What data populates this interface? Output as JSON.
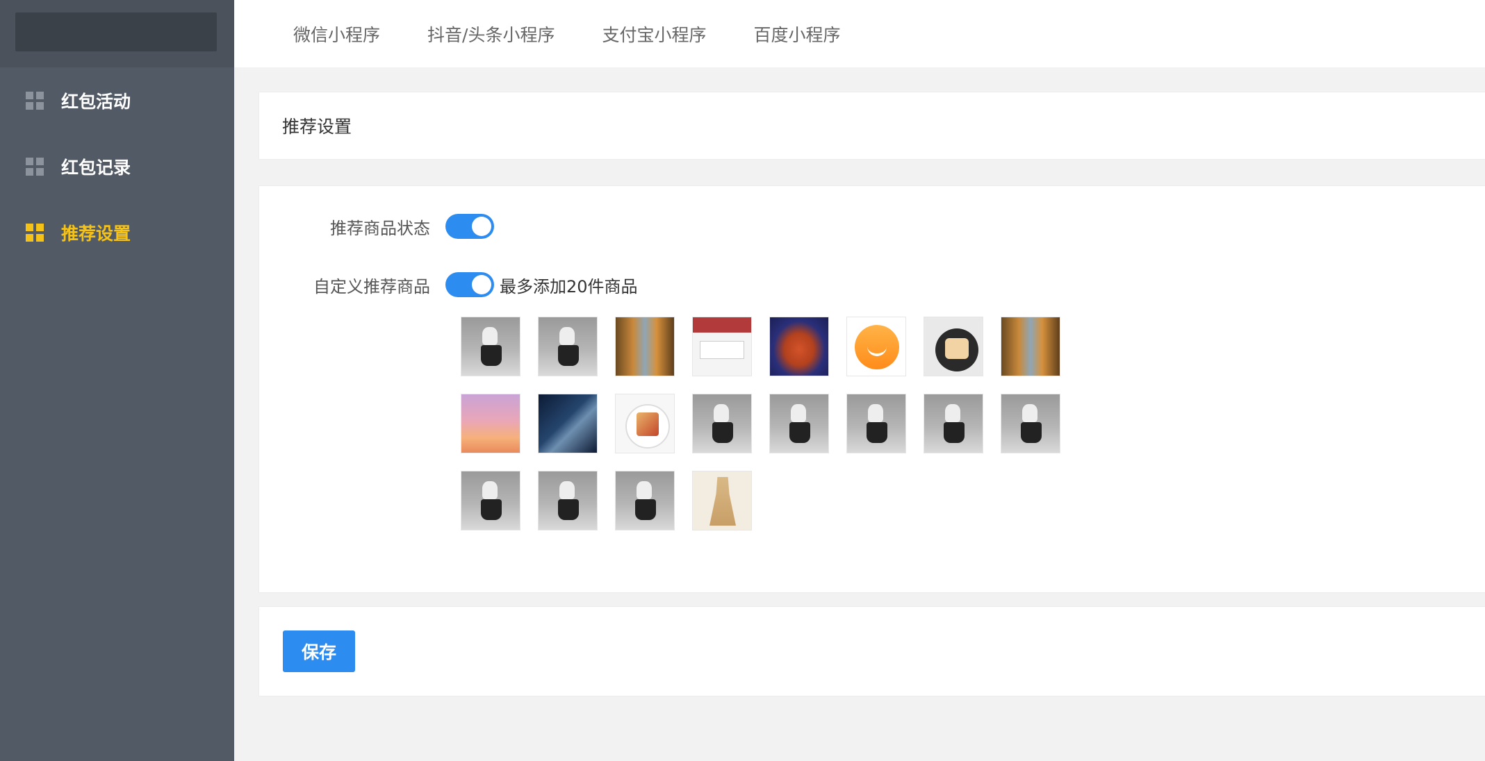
{
  "sidebar": {
    "items": [
      {
        "label": "红包活动",
        "icon": "grid-icon",
        "active": false
      },
      {
        "label": "红包记录",
        "icon": "grid-icon",
        "active": false
      },
      {
        "label": "推荐设置",
        "icon": "grid-icon",
        "active": true
      }
    ]
  },
  "tabs": [
    {
      "label": "微信小程序"
    },
    {
      "label": "抖音/头条小程序"
    },
    {
      "label": "支付宝小程序"
    },
    {
      "label": "百度小程序"
    }
  ],
  "section": {
    "title": "推荐设置"
  },
  "form": {
    "status_label": "推荐商品状态",
    "status_on": true,
    "custom_label": "自定义推荐商品",
    "custom_on": true,
    "custom_hint": "最多添加20件商品",
    "products": [
      {
        "image": "person-photo"
      },
      {
        "image": "person-photo"
      },
      {
        "image": "gold-ornament-photo"
      },
      {
        "image": "app-screenshot"
      },
      {
        "image": "food-dish-photo"
      },
      {
        "image": "smile-chat-icon"
      },
      {
        "image": "bowl-food-photo"
      },
      {
        "image": "gold-ornament-photo"
      },
      {
        "image": "sunset-photo"
      },
      {
        "image": "night-scene-photo"
      },
      {
        "image": "plate-food-photo"
      },
      {
        "image": "person-photo"
      },
      {
        "image": "person-photo"
      },
      {
        "image": "person-photo"
      },
      {
        "image": "person-photo"
      },
      {
        "image": "person-photo"
      },
      {
        "image": "person-photo"
      },
      {
        "image": "person-photo"
      },
      {
        "image": "person-photo"
      },
      {
        "image": "dress-photo"
      }
    ]
  },
  "actions": {
    "save_label": "保存"
  },
  "colors": {
    "sidebar_bg": "#525a65",
    "active_accent": "#f5c218",
    "primary_blue": "#2d8cf0"
  }
}
